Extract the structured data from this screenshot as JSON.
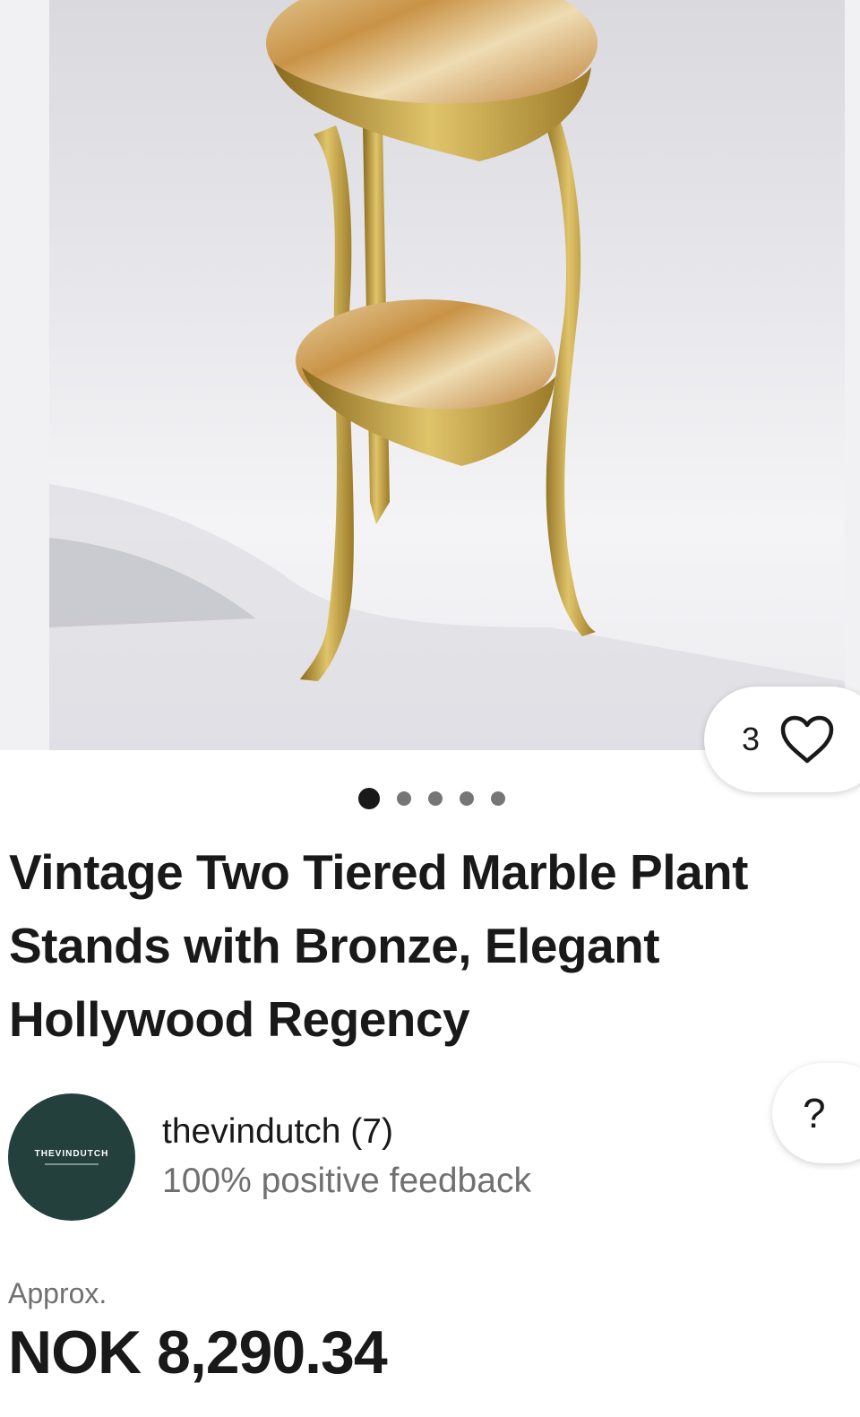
{
  "gallery": {
    "image_alt": "Vintage two tiered marble plant stand with bronze frame",
    "watch_count": "3",
    "watch_icon": "heart-icon",
    "dots_total": 5,
    "active_dot": 1
  },
  "listing": {
    "title": "Vintage Two Tiered Marble Plant Stands with Bronze, Elegant Hollywood Regency"
  },
  "help": {
    "label": "?"
  },
  "seller": {
    "avatar_text": "THEVINDUTCH",
    "name": "thevindutch (7)",
    "feedback": "100% positive feedback"
  },
  "price": {
    "approx_label": "Approx.",
    "amount": "NOK 8,290.34"
  },
  "colors": {
    "avatar_bg": "#24403d",
    "text_primary": "#191919",
    "text_secondary": "#707070"
  }
}
